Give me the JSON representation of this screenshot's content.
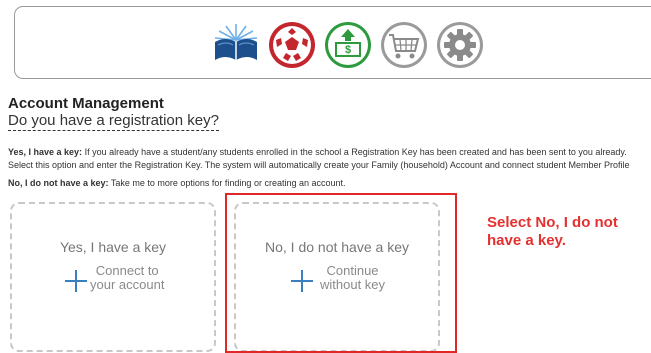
{
  "toolbar": {
    "icons": [
      {
        "name": "book-icon",
        "color": "#1c4f8c"
      },
      {
        "name": "soccer-ball-icon",
        "color": "#c4262e"
      },
      {
        "name": "money-icon",
        "color": "#2e9a3e"
      },
      {
        "name": "shopping-cart-icon",
        "color": "#9a9a9a"
      },
      {
        "name": "gear-icon",
        "color": "#9a9a9a"
      }
    ]
  },
  "page": {
    "title": "Account Management",
    "question": "Do you have a registration key?"
  },
  "options_text": {
    "yes_label": "Yes, I have a key:",
    "yes_line1": " If you already have a student/any students enrolled in the school a Registration Key has been created and has been sent to you already.",
    "yes_line2": "Select this option and enter the Registration Key. The system will automatically create your Family (household) Account and connect student Member Profile",
    "no_label": "No, I do not have a key:",
    "no_text": " Take me to more options for finding or creating an account."
  },
  "cards": [
    {
      "title": "Yes, I have a key",
      "sub1": "Connect to",
      "sub2": "your account"
    },
    {
      "title": "No, I do not have a key",
      "sub1": "Continue",
      "sub2": "without key"
    }
  ],
  "annotation": {
    "line1": "Select No, I do not",
    "line2": "have a key.",
    "color": "#e53030"
  }
}
